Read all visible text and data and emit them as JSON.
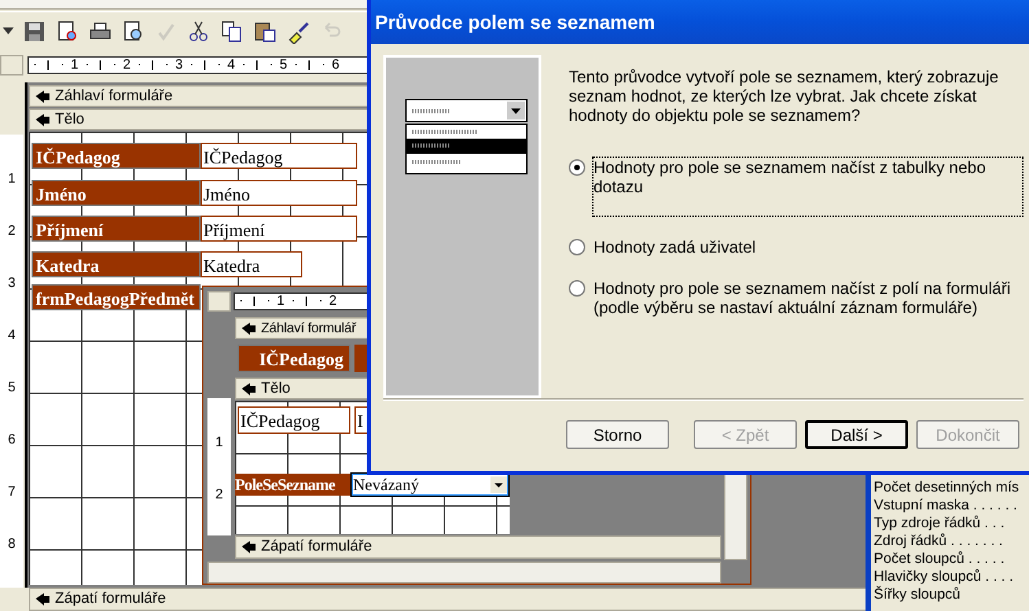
{
  "toolbar": [
    {
      "kind": "dropdown",
      "disabled": false
    },
    {
      "kind": "save",
      "disabled": false
    },
    {
      "kind": "search-file",
      "disabled": false
    },
    {
      "kind": "print",
      "disabled": false
    },
    {
      "kind": "preview",
      "disabled": false
    },
    {
      "kind": "spell",
      "disabled": true
    },
    {
      "kind": "cut",
      "disabled": false
    },
    {
      "kind": "copy",
      "disabled": false
    },
    {
      "kind": "paste",
      "disabled": false
    },
    {
      "kind": "brush",
      "disabled": false
    },
    {
      "kind": "undo",
      "disabled": true
    }
  ],
  "ruler": [
    "1",
    "2",
    "3",
    "4",
    "5",
    "6"
  ],
  "vertical_ruler": [
    "1",
    "2",
    "3",
    "4",
    "5",
    "6",
    "7",
    "8"
  ],
  "main_form": {
    "header_section": "Záhlaví formuláře",
    "body_section": "Tělo",
    "footer_section": "Zápatí formuláře",
    "fields": [
      {
        "label": "IČPedagog",
        "value": "IČPedagog"
      },
      {
        "label": "Jméno",
        "value": "Jméno"
      },
      {
        "label": "Příjmení",
        "value": "Příjmení"
      },
      {
        "label": "Katedra",
        "value": "Katedra"
      }
    ],
    "subform_label": "frmPedagogPředmět"
  },
  "subform": {
    "ruler": [
      "1",
      "2"
    ],
    "vertical_ruler": [
      "1",
      "2"
    ],
    "header_section": "Záhlaví formulář",
    "header_label": "IČPedagog",
    "body_section": "Tělo",
    "body_fields": [
      "IČPedagog",
      "I"
    ],
    "combo": {
      "label": "PoleSeSezname",
      "value": "Nevázaný",
      "selected": true
    },
    "footer_section": "Zápatí formuláře"
  },
  "property_sheet": [
    "Počet desetinných mís",
    "Vstupní maska . . . . . .",
    "Typ zdroje řádků . . .",
    "Zdroj řádků . . . . . . .",
    "Počet sloupců . . . . .",
    "Hlavičky sloupců . . . .",
    "Šířky sloupců"
  ],
  "dialog": {
    "title": "Průvodce polem se seznamem",
    "intro": "Tento průvodce vytvoří pole se seznamem, který zobrazuje seznam hodnot, ze kterých lze vybrat. Jak chcete získat hodnoty do objektu pole se seznamem?",
    "options": [
      {
        "label": "Hodnoty pro pole se seznamem načíst z tabulky nebo dotazu",
        "selected": true
      },
      {
        "label": "Hodnoty zadá uživatel",
        "selected": false
      },
      {
        "label": "Hodnoty pro pole se seznamem načíst z polí na formuláři (podle výběru se nastaví aktuální záznam formuláře)",
        "selected": false
      }
    ],
    "buttons": [
      {
        "label": "Storno",
        "disabled": false,
        "default": false
      },
      {
        "label": "< Zpět",
        "disabled": true,
        "default": false
      },
      {
        "label": "Další >",
        "disabled": false,
        "default": true
      },
      {
        "label": "Dokončit",
        "disabled": true,
        "default": false
      }
    ]
  }
}
